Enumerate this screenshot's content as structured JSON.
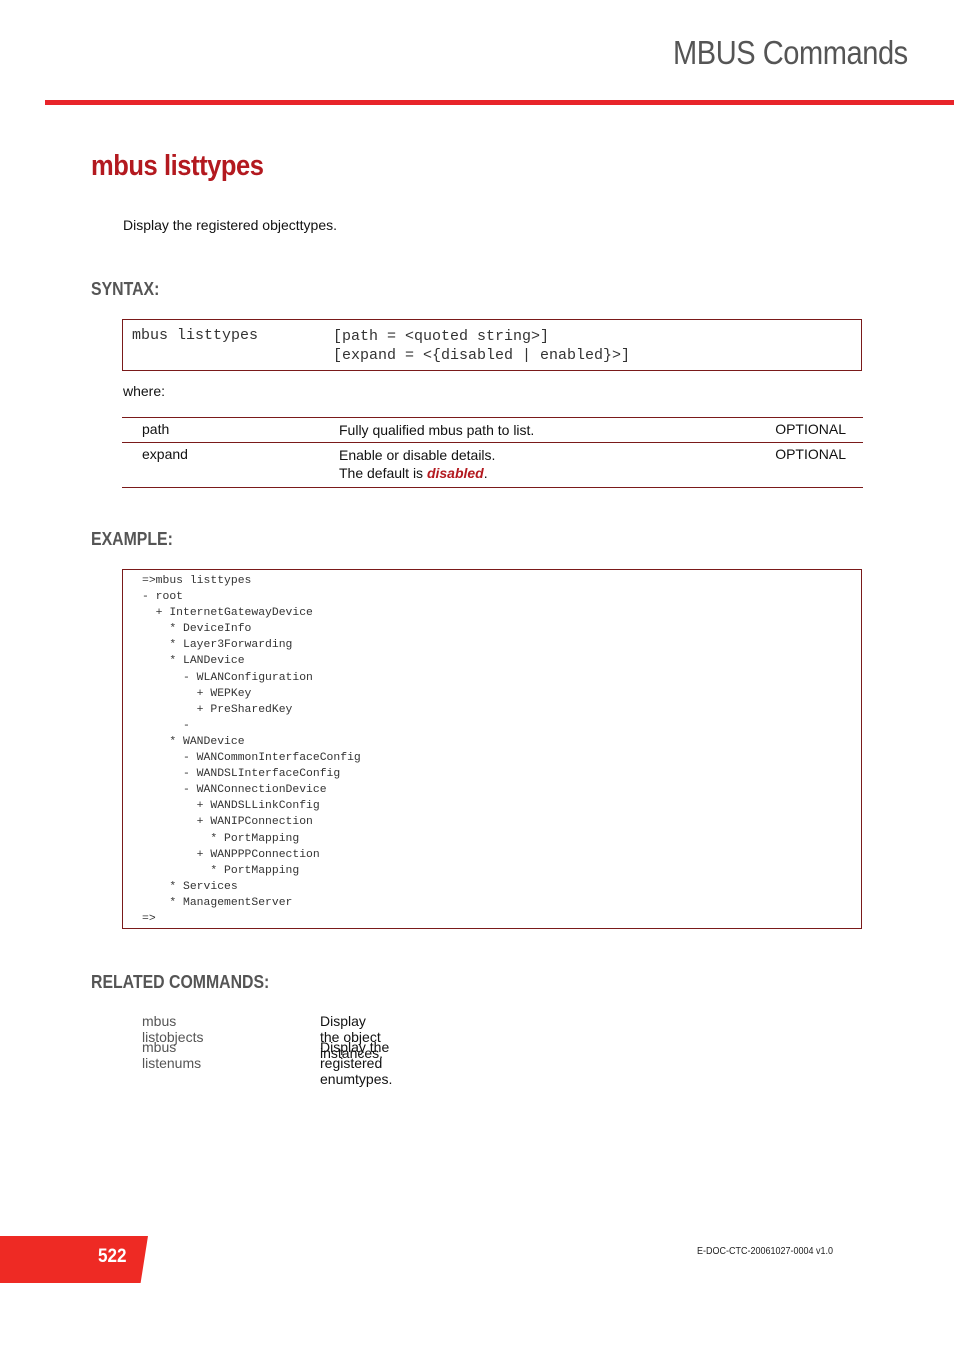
{
  "header": {
    "chapter_title": "MBUS Commands"
  },
  "command": {
    "title": "mbus listtypes",
    "description": "Display the registered objecttypes."
  },
  "syntax": {
    "heading": "SYNTAX:",
    "command": "mbus listtypes",
    "params": [
      "[path = <quoted string>]",
      "[expand = <{disabled | enabled}>]"
    ],
    "where_label": "where:"
  },
  "parameters": [
    {
      "name": "path",
      "description": "Fully qualified mbus path to list.",
      "default_text": "",
      "default_value": "",
      "default_suffix": "",
      "requirement": "OPTIONAL"
    },
    {
      "name": "expand",
      "description": "Enable or disable details.",
      "default_text": "The default is ",
      "default_value": "disabled",
      "default_suffix": ".",
      "requirement": "OPTIONAL"
    }
  ],
  "example": {
    "heading": "EXAMPLE:",
    "lines": [
      "=>mbus listtypes",
      "- root",
      "  + InternetGatewayDevice",
      "    * DeviceInfo",
      "    * Layer3Forwarding",
      "    * LANDevice",
      "      - WLANConfiguration",
      "        + WEPKey",
      "        + PreSharedKey",
      "      -",
      "    * WANDevice",
      "      - WANCommonInterfaceConfig",
      "      - WANDSLInterfaceConfig",
      "      - WANConnectionDevice",
      "        + WANDSLLinkConfig",
      "        + WANIPConnection",
      "          * PortMapping",
      "        + WANPPPConnection",
      "          * PortMapping",
      "    * Services",
      "    * ManagementServer",
      "=>"
    ]
  },
  "related": {
    "heading": "RELATED COMMANDS:",
    "items": [
      {
        "name": "mbus listobjects",
        "description": "Display the object instances."
      },
      {
        "name": "mbus listenums",
        "description": "Display the registered enumtypes."
      }
    ]
  },
  "footer": {
    "page_number": "522",
    "doc_id": "E-DOC-CTC-20061027-0004 v1.0"
  },
  "colors": {
    "accent_red": "#e8242a",
    "title_red": "#b3191f",
    "border_dark_red": "#7a1a1a",
    "heading_gray": "#555555"
  }
}
